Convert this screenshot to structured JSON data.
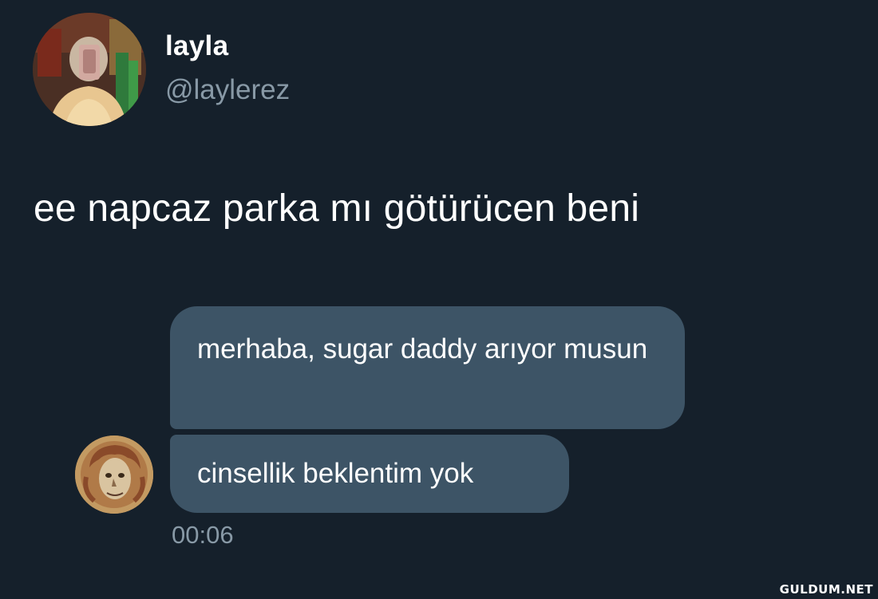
{
  "profile": {
    "display_name": "layla",
    "handle": "@laylerez",
    "avatar_icon": "profile-photo"
  },
  "tweet": {
    "text": "ee napcaz parka mı götürücen beni"
  },
  "embedded_dm": {
    "messages": [
      {
        "text": "merhaba,  sugar daddy arıyor musun"
      },
      {
        "text": "cinsellik beklentim yok"
      }
    ],
    "sender_avatar_icon": "painted-portrait",
    "timestamp": "00:06"
  },
  "watermark": "GULDUM.NET",
  "colors": {
    "background": "#15202b",
    "bubble": "#3d5466",
    "muted_text": "#8899a6"
  }
}
